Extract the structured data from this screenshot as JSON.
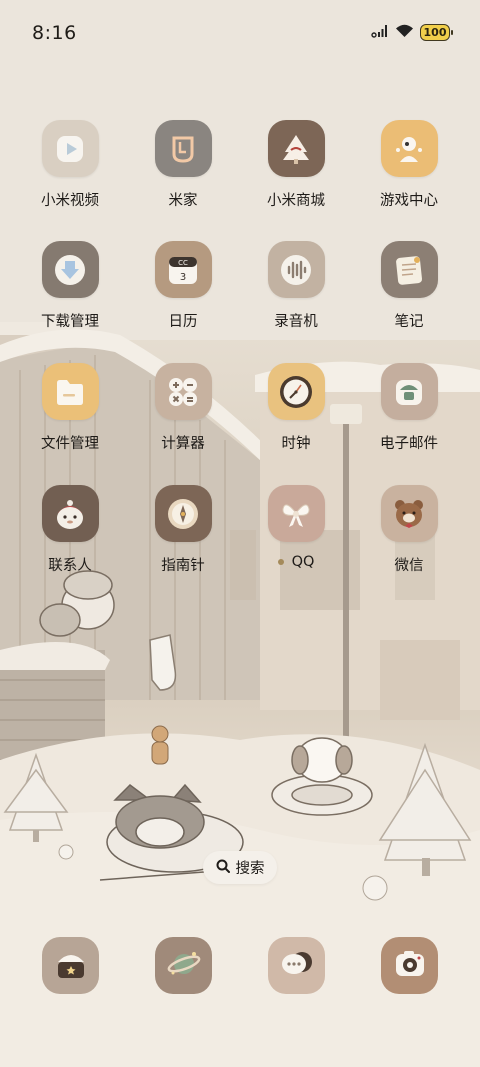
{
  "status_bar": {
    "time": "8:16",
    "battery": "100",
    "icons": [
      "signal-icon",
      "wifi-icon",
      "battery-icon"
    ]
  },
  "apps": [
    {
      "label": "小米视频",
      "icon": "video-play-icon",
      "color": "#d9cfc2"
    },
    {
      "label": "米家",
      "icon": "mijia-icon",
      "color": "#8a8580"
    },
    {
      "label": "小米商城",
      "icon": "tree-shop-icon",
      "color": "#7d6656"
    },
    {
      "label": "游戏中心",
      "icon": "game-character-icon",
      "color": "#ebbd75"
    },
    {
      "label": "下载管理",
      "icon": "download-icon",
      "color": "#857a70"
    },
    {
      "label": "日历",
      "icon": "calendar-icon",
      "color": "#b59a80"
    },
    {
      "label": "录音机",
      "icon": "sound-wave-icon",
      "color": "#c2b2a2"
    },
    {
      "label": "笔记",
      "icon": "notepad-icon",
      "color": "#8c7f74"
    },
    {
      "label": "文件管理",
      "icon": "folder-icon",
      "color": "#ebc078"
    },
    {
      "label": "计算器",
      "icon": "calculator-icon",
      "color": "#c7b2a0"
    },
    {
      "label": "时钟",
      "icon": "clock-icon",
      "color": "#e9c27f"
    },
    {
      "label": "电子邮件",
      "icon": "mail-plant-icon",
      "color": "#c4ae9e"
    },
    {
      "label": "联系人",
      "icon": "contact-avatar-icon",
      "color": "#725f52"
    },
    {
      "label": "指南针",
      "icon": "compass-icon",
      "color": "#7d6656"
    },
    {
      "label": "QQ",
      "icon": "bow-icon",
      "color": "#c9a99a",
      "has_dot": true
    },
    {
      "label": "微信",
      "icon": "bear-icon",
      "color": "#c9b29f"
    }
  ],
  "search": {
    "label": "搜索",
    "icon": "search-icon"
  },
  "dock": [
    {
      "name": "dock-app-1",
      "icon": "bag-icon",
      "color": "#b7a596"
    },
    {
      "name": "dock-app-2",
      "icon": "planet-icon",
      "color": "#a08a7a"
    },
    {
      "name": "dock-app-3",
      "icon": "chat-bubble-icon",
      "color": "#d0b9a8"
    },
    {
      "name": "dock-app-4",
      "icon": "camera-icon",
      "color": "#b28e74"
    }
  ]
}
